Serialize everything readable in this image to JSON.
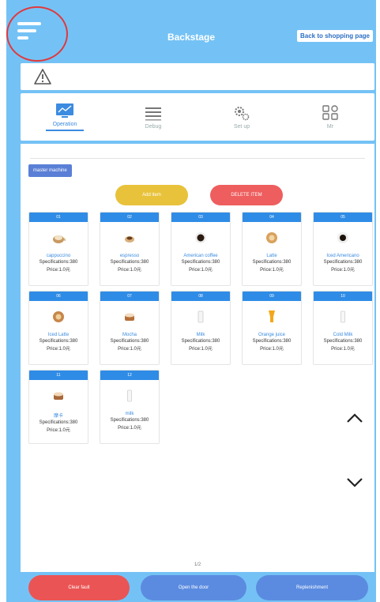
{
  "header": {
    "title": "Backstage",
    "back_label": "Back to shopping page"
  },
  "nav": {
    "items": [
      {
        "label": "Operation",
        "icon": "chart-monitor-icon",
        "active": true
      },
      {
        "label": "Debug",
        "icon": "list-icon",
        "active": false
      },
      {
        "label": "Set up",
        "icon": "gears-icon",
        "active": false
      },
      {
        "label": "Mr",
        "icon": "grid-icon",
        "active": false
      }
    ]
  },
  "main": {
    "mode_label": "master machine",
    "add_label": "Add item",
    "delete_label": "DELETE ITEM",
    "page_indicator": "1/2"
  },
  "products": [
    {
      "num": "01",
      "name": "cappuccino",
      "spec": "Specifications:380",
      "price": "Price:1.0元"
    },
    {
      "num": "02",
      "name": "espresso",
      "spec": "Specifications:380",
      "price": "Price:1.0元"
    },
    {
      "num": "03",
      "name": "American coffee",
      "spec": "Specifications:380",
      "price": "Price:1.0元"
    },
    {
      "num": "04",
      "name": "Latte",
      "spec": "Specifications:380",
      "price": "Price:1.0元"
    },
    {
      "num": "05",
      "name": "Iced Americano",
      "spec": "Specifications:380",
      "price": "Price:1.0元"
    },
    {
      "num": "06",
      "name": "Iced Latte",
      "spec": "Specifications:380",
      "price": "Price:1.0元"
    },
    {
      "num": "07",
      "name": "Mocha",
      "spec": "Specifications:380",
      "price": "Price:1.0元"
    },
    {
      "num": "08",
      "name": "Milk",
      "spec": "Specifications:380",
      "price": "Price:1.0元"
    },
    {
      "num": "09",
      "name": "Orange juice",
      "spec": "Specifications:380",
      "price": "Price:1.0元"
    },
    {
      "num": "10",
      "name": "Cold Milk",
      "spec": "Specifications:380",
      "price": "Price:1.0元"
    },
    {
      "num": "11",
      "name": "摩卡",
      "spec": "Specifications:380",
      "price": "Price:1.0元"
    },
    {
      "num": "12",
      "name": "milk",
      "spec": "Specifications:380",
      "price": "Price:1.0元"
    }
  ],
  "footer": {
    "clear_label": "Clear fault",
    "open_label": "Open the door",
    "replenish_label": "Replenishment"
  },
  "colors": {
    "frame": "#74c2f5",
    "accent": "#2f8ce6",
    "add": "#e8c23a",
    "delete": "#ee5e5e",
    "clear": "#ea5454",
    "open": "#5b8be0",
    "replenish": "#5b8be0"
  }
}
